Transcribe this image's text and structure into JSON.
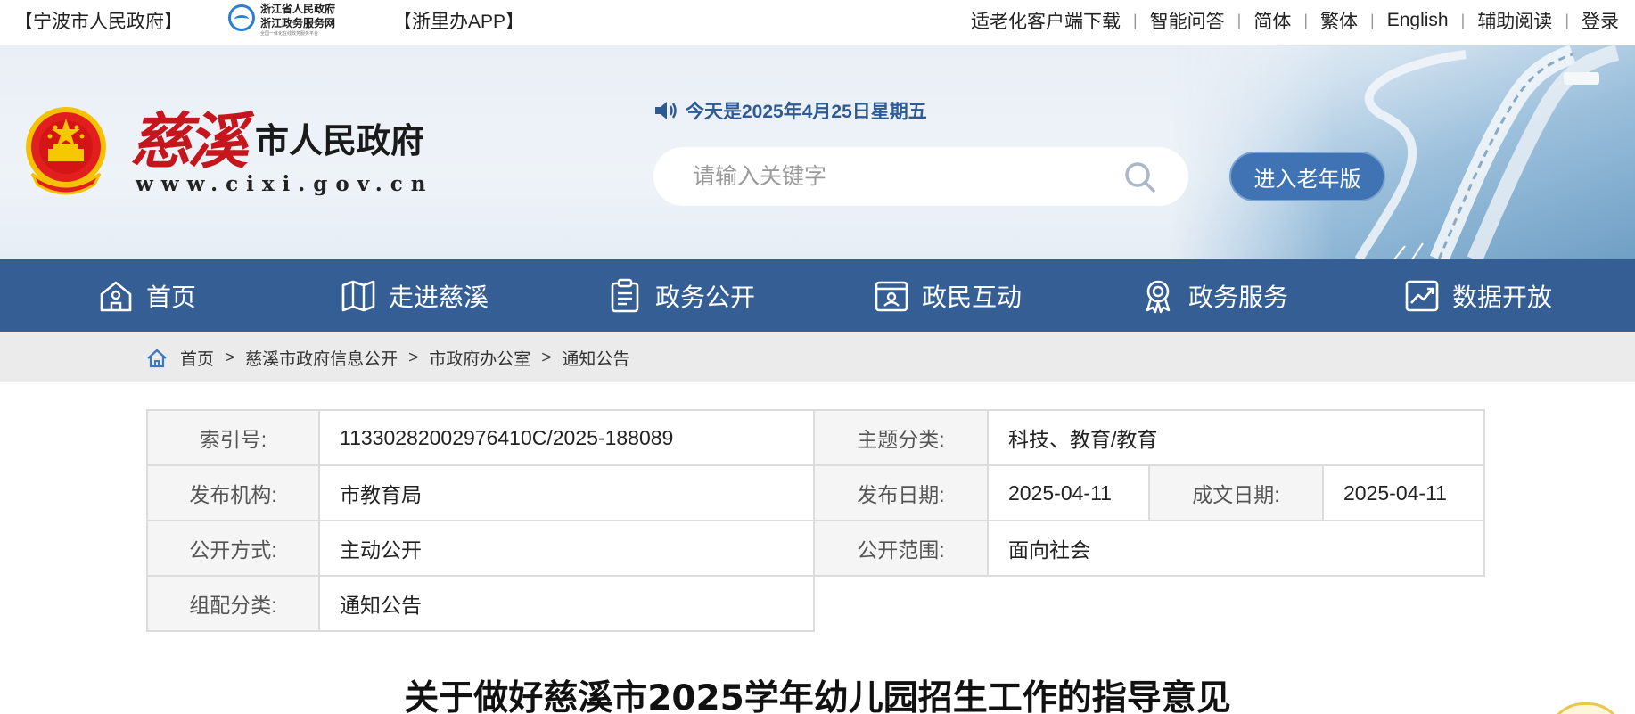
{
  "topbar": {
    "ningbo_link": "【宁波市人民政府】",
    "zj_logo": {
      "line1": "浙江省人民政府",
      "line2": "浙江政务服务网",
      "line3": "全国一体化在线政务服务平台"
    },
    "zlb_link": "【浙里办APP】",
    "right_links": [
      "适老化客户端下载",
      "智能问答",
      "简体",
      "繁体",
      "English",
      "辅助阅读",
      "登录"
    ]
  },
  "header": {
    "site_name_cixi": "慈溪",
    "site_name_gov": "市人民政府",
    "site_url": "www.cixi.gov.cn",
    "date_text": "今天是2025年4月25日星期五",
    "search_placeholder": "请输入关键字",
    "elder_button": "进入老年版"
  },
  "nav": {
    "items": [
      {
        "label": "首页",
        "icon": "home-icon"
      },
      {
        "label": "走进慈溪",
        "icon": "map-icon"
      },
      {
        "label": "政务公开",
        "icon": "clipboard-icon"
      },
      {
        "label": "政民互动",
        "icon": "id-card-icon"
      },
      {
        "label": "政务服务",
        "icon": "award-icon"
      },
      {
        "label": "数据开放",
        "icon": "chart-icon"
      }
    ]
  },
  "breadcrumb": {
    "items": [
      "首页",
      "慈溪市政府信息公开",
      "市政府办公室",
      "通知公告"
    ],
    "separator": ">"
  },
  "info_table": {
    "index_label": "索引号:",
    "index_value": "11330282002976410C/2025-188089",
    "topic_label": "主题分类:",
    "topic_value": "科技、教育/教育",
    "publisher_label": "发布机构:",
    "publisher_value": "市教育局",
    "pub_date_label": "发布日期:",
    "pub_date_value": "2025-04-11",
    "doc_date_label": "成文日期:",
    "doc_date_value": "2025-04-11",
    "open_mode_label": "公开方式:",
    "open_mode_value": "主动公开",
    "open_scope_label": "公开范围:",
    "open_scope_value": "面向社会",
    "category_label": "组配分类:",
    "category_value": "通知公告"
  },
  "article": {
    "title": "关于做好慈溪市2025学年幼儿园招生工作的指导意见"
  },
  "colors": {
    "nav_bg": "#355f94",
    "accent_blue": "#3f73b4",
    "brand_red": "#c4161c",
    "crumb_bg": "#ebebeb"
  }
}
